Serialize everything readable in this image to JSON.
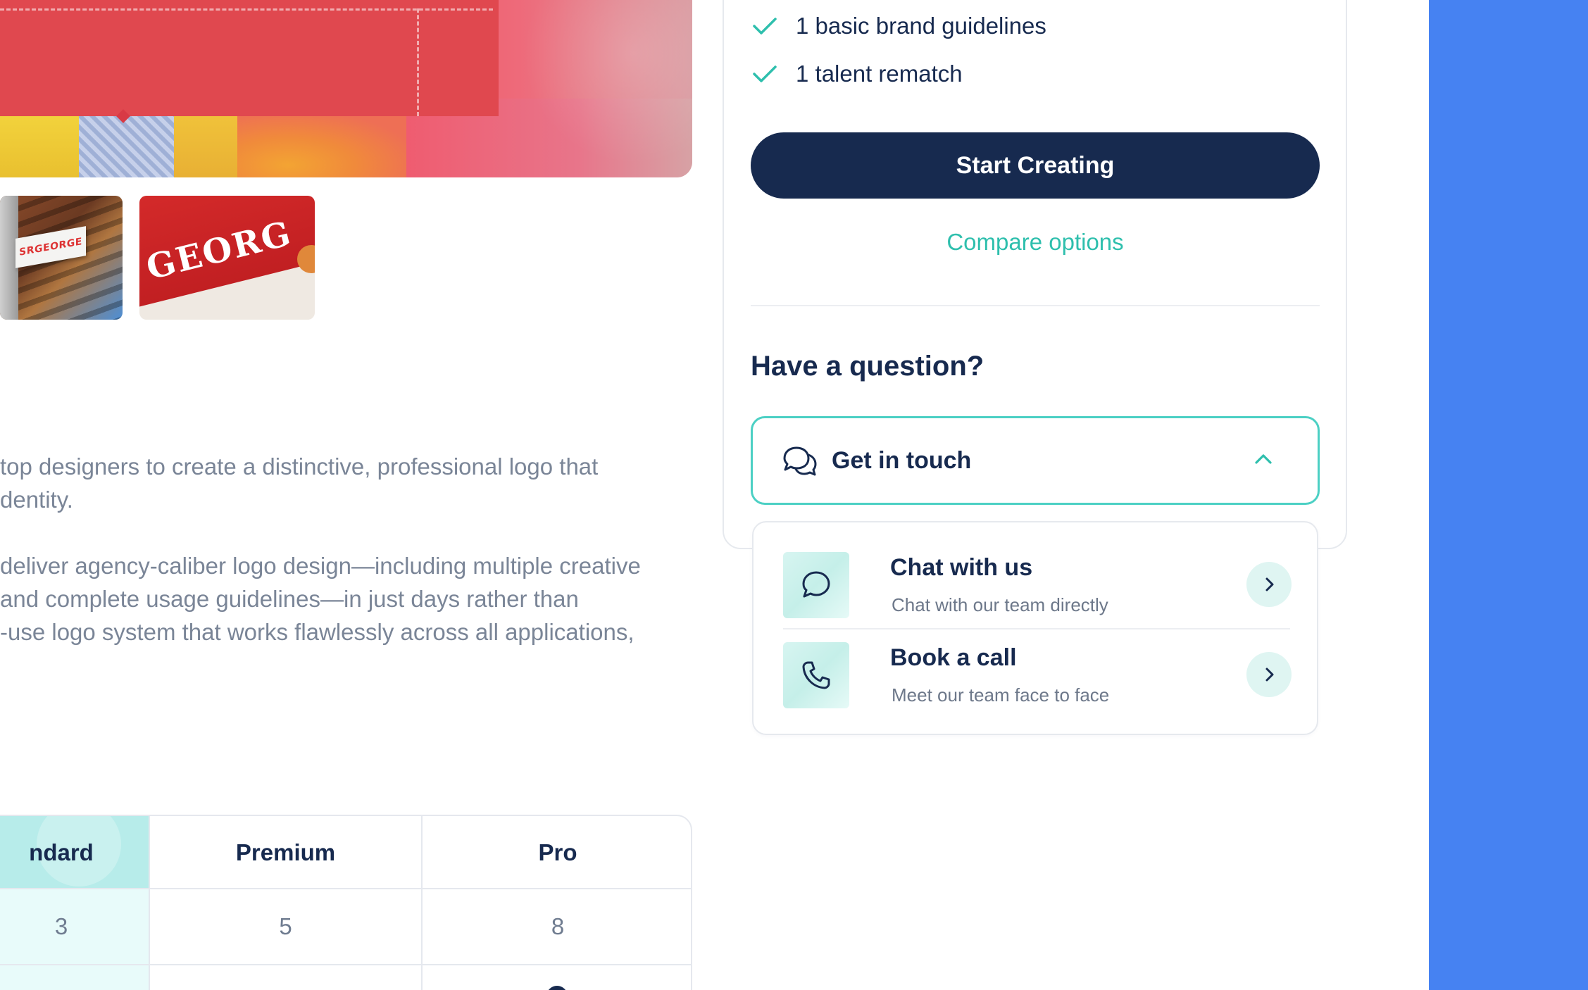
{
  "hero": {
    "thumbnail_1_sign": "SRGEORGE",
    "thumbnail_2_word": "GEORG"
  },
  "description": {
    "lines": [
      "top designers to create a distinctive, professional logo that",
      "dentity.",
      "deliver agency-caliber logo design—including multiple creative",
      "and complete usage guidelines—in just days rather than",
      "-use logo system that works flawlessly across all applications,"
    ]
  },
  "comparison_table": {
    "headers": [
      "ndard",
      "Premium",
      "Pro"
    ],
    "row1": [
      "3",
      "5",
      "8"
    ]
  },
  "pricing_card": {
    "features": [
      "1 basic brand guidelines",
      "1 talent rematch"
    ],
    "start_button": "Start Creating",
    "compare_link": "Compare options",
    "question_heading": "Have a question?",
    "get_in_touch": "Get in touch",
    "options": [
      {
        "title": "Chat with us",
        "subtitle": "Chat with our team directly",
        "icon": "chat-bubble-icon"
      },
      {
        "title": "Book a call",
        "subtitle": "Meet our team face to face",
        "icon": "phone-icon"
      }
    ]
  },
  "colors": {
    "primary_navy": "#172a4f",
    "accent_teal": "#2ebfad",
    "teal_border": "#4cd0c4",
    "standard_column": "#b7ecea",
    "side_strip_blue": "#4682f2"
  }
}
